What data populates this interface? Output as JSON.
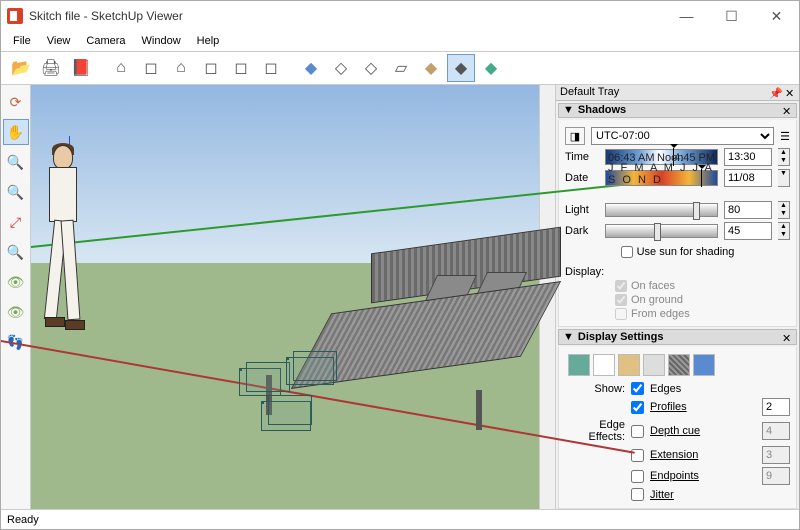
{
  "window": {
    "title": "Skitch file - SketchUp Viewer"
  },
  "menu": {
    "items": [
      "File",
      "View",
      "Camera",
      "Window",
      "Help"
    ]
  },
  "toolbar": {
    "group1": [
      "open-icon",
      "paint-icon",
      "box-red-icon"
    ],
    "group2": [
      "house-icon",
      "box-icon",
      "house2-icon",
      "box2-icon",
      "box3-icon",
      "boxes-icon"
    ],
    "group3": [
      "cube-blue-icon",
      "cube-wire-icon",
      "cube-hidden-icon",
      "sheet-icon",
      "cube-tan-icon",
      "cube-striped-icon",
      "cube-color-icon"
    ]
  },
  "left_tools": [
    "orbit-icon",
    "hand-icon",
    "zoom-icon",
    "zoom-sel-icon",
    "zoom-ext-icon",
    "prev-icon",
    "eye-icon",
    "shadow-toggle-icon",
    "footprints-icon"
  ],
  "tray": {
    "title": "Default Tray",
    "shadows": {
      "title": "Shadows",
      "tz": "UTC-07:00",
      "time_label": "Time",
      "time_sunrise": "06:43 AM",
      "time_noon": "Noon",
      "time_sunset": "4:45 PM",
      "time_value": "13:30",
      "date_label": "Date",
      "date_months": "J F M A M J J A S O N D",
      "date_value": "11/08",
      "light_label": "Light",
      "light_value": "80",
      "dark_label": "Dark",
      "dark_value": "45",
      "sun_shading": "Use sun for shading",
      "display_label": "Display:",
      "on_faces": "On faces",
      "on_ground": "On ground",
      "from_edges": "From edges"
    },
    "ds": {
      "title": "Display Settings",
      "show_label": "Show:",
      "edges": "Edges",
      "profiles": "Profiles",
      "profiles_v": "2",
      "ee_label": "Edge Effects:",
      "depth": "Depth cue",
      "depth_v": "4",
      "ext": "Extension",
      "ext_v": "3",
      "endp": "Endpoints",
      "endp_v": "9",
      "jitter": "Jitter"
    }
  },
  "status": {
    "text": "Ready"
  }
}
